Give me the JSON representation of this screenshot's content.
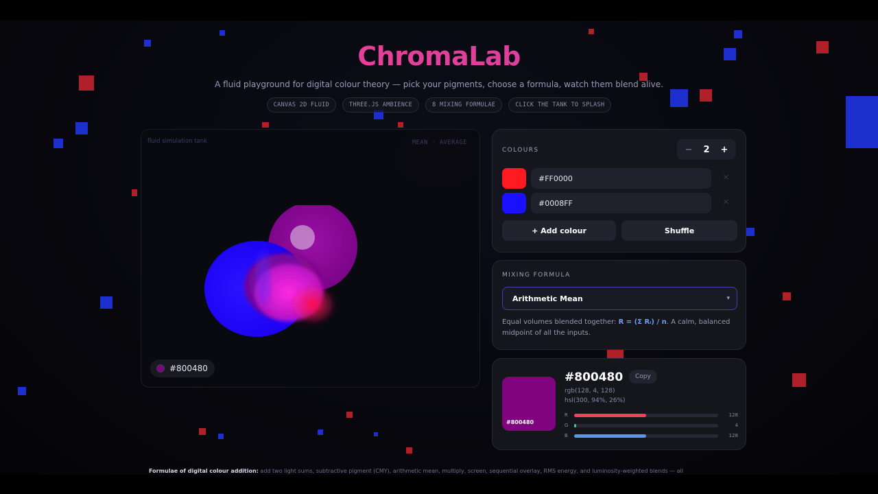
{
  "header": {
    "title": "ChromaLab",
    "subtitle": "A fluid playground for digital colour theory — pick your pigments, choose a formula, watch them blend alive.",
    "chips": [
      "CANVAS 2D FLUID",
      "THREE.JS AMBIENCE",
      "8 MIXING FORMULAE",
      "CLICK THE TANK TO SPLASH"
    ]
  },
  "simulation": {
    "label": "fluid simulation tank",
    "mode": "MEAN · AVERAGE",
    "result_hex": "#800480"
  },
  "colours_panel": {
    "label": "COLOURS",
    "count": "2",
    "decrement_icon": "minus-icon",
    "increment_icon": "plus-icon",
    "items": [
      {
        "hex": "#FF0000",
        "swatch": "#ff1a22"
      },
      {
        "hex": "#0008FF",
        "swatch": "#1a10ff"
      }
    ],
    "remove_icon": "close-icon",
    "add_label": "+ Add colour",
    "shuffle_label": "Shuffle"
  },
  "formula_panel": {
    "label": "MIXING FORMULA",
    "selected": "Arithmetic Mean",
    "desc_before": "Equal volumes blended together: ",
    "equation": "R = (Σ Rᵢ) / n",
    "desc_after": ". A calm, balanced midpoint of all the inputs."
  },
  "result_panel": {
    "hex": "#800480",
    "copy_label": "Copy",
    "rgb_text": "rgb(128, 4, 128)",
    "hsl_text": "hsl(300, 94%, 26%)",
    "channels": [
      {
        "label": "R",
        "value": "128",
        "level": 0.502,
        "color": "#f0425a"
      },
      {
        "label": "G",
        "value": "4",
        "level": 0.016,
        "color": "#3ac7a0"
      },
      {
        "label": "B",
        "value": "128",
        "level": 0.502,
        "color": "#5a96f0"
      }
    ]
  },
  "footer": {
    "strong": "Formulae of digital colour addition:",
    "text": " add two light sums, subtractive pigment (CMY), arithmetic mean, multiply, screen, sequential overlay, RMS energy, and luminosity-weighted blends — all"
  }
}
